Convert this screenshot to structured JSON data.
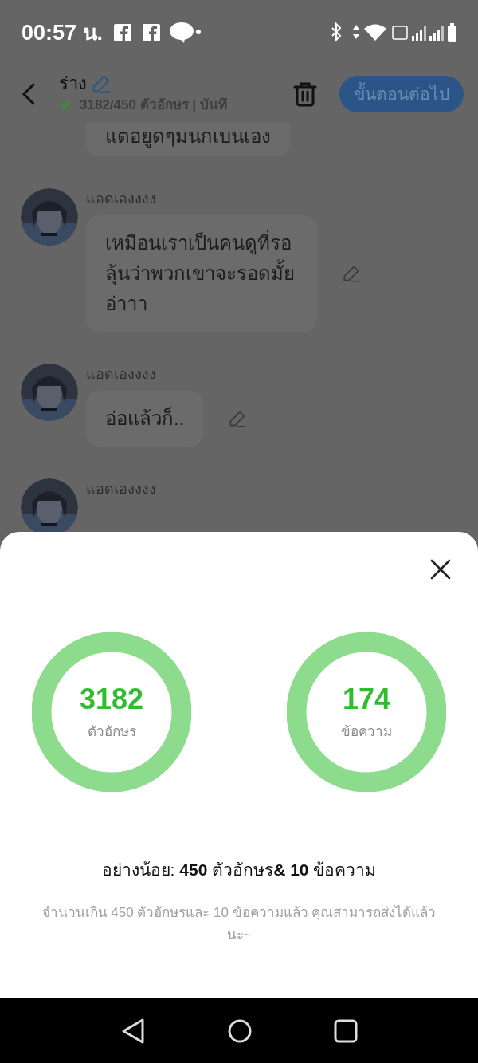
{
  "status_bar": {
    "time": "00:57 น."
  },
  "header": {
    "title": "ร่าง",
    "subtitle": "3182/450 ตัวอักษร | บันทึ",
    "next_button": "ขั้นตอนต่อไป"
  },
  "messages": [
    {
      "text": "แตอยูดๆมนกเบนเอง",
      "kind": "partial"
    },
    {
      "name": "แอดเองงงง",
      "text": "เหมือนเราเป็นคนดูที่รอลุ้นว่าพวกเขาจะรอดมั้ยอ่าาา",
      "kind": "full"
    },
    {
      "name": "แอดเองงงง",
      "text": "อ่อแล้วก็..",
      "kind": "full"
    },
    {
      "name": "แอดเองงงง",
      "kind": "cut"
    }
  ],
  "sheet": {
    "stats": [
      {
        "value": "3182",
        "label": "ตัวอักษร"
      },
      {
        "value": "174",
        "label": "ข้อความ"
      }
    ],
    "minimum": "อย่างน้อย: **450** ตัวอักษร**& 10** ข้อความ",
    "note": "จำนวนเกิน 450 ตัวอักษรและ 10 ข้อความแล้ว คุณสามารถส่งได้แล้วนะ~"
  }
}
